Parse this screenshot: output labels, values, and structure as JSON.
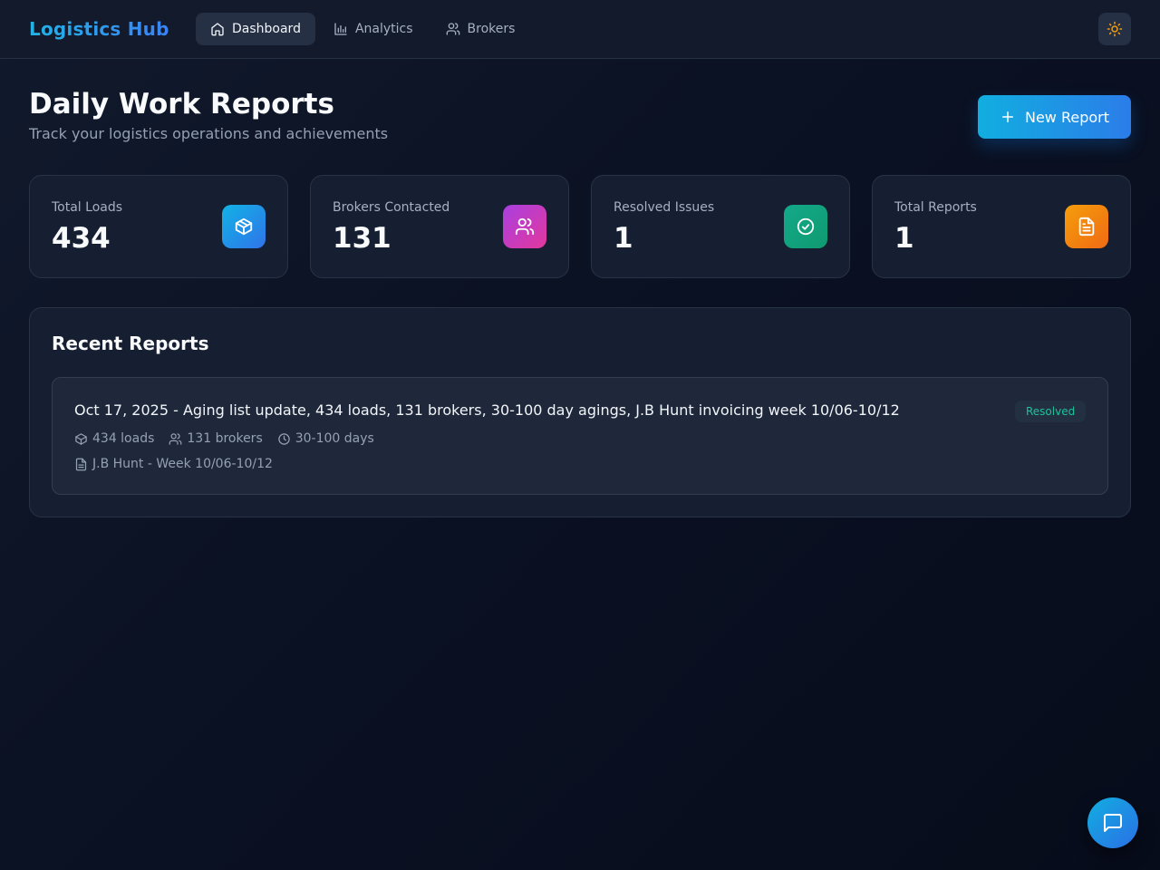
{
  "app": {
    "brand": "Logistics Hub"
  },
  "nav": {
    "items": [
      {
        "label": "Dashboard",
        "icon": "home-icon",
        "active": true
      },
      {
        "label": "Analytics",
        "icon": "bar-chart-icon",
        "active": false
      },
      {
        "label": "Brokers",
        "icon": "users-icon",
        "active": false
      }
    ],
    "theme_toggle_icon": "sun-icon"
  },
  "header": {
    "title": "Daily Work Reports",
    "subtitle": "Track your logistics operations and achievements",
    "new_report_label": "New Report"
  },
  "stats": [
    {
      "label": "Total Loads",
      "value": "434",
      "icon": "box-icon",
      "color": "#1aa3e4"
    },
    {
      "label": "Brokers Contacted",
      "value": "131",
      "icon": "users-icon",
      "color": "#c43ad6"
    },
    {
      "label": "Resolved Issues",
      "value": "1",
      "icon": "check-circle-icon",
      "color": "#12a27c"
    },
    {
      "label": "Total Reports",
      "value": "1",
      "icon": "file-text-icon",
      "color": "#f47a12"
    }
  ],
  "recent": {
    "title": "Recent Reports",
    "reports": [
      {
        "title": "Oct 17, 2025 - Aging list update, 434 loads, 131 brokers, 30-100 day agings, J.B Hunt invoicing week 10/06-10/12",
        "status": "Resolved",
        "loads": "434 loads",
        "brokers": "131 brokers",
        "aging": "30-100 days",
        "invoice": "J.B Hunt - Week 10/06-10/12"
      }
    ]
  },
  "colors": {
    "accent_start": "#11aee0",
    "accent_end": "#2b7de9",
    "resolved": "#1ec29a",
    "sun": "#f59e0b"
  }
}
